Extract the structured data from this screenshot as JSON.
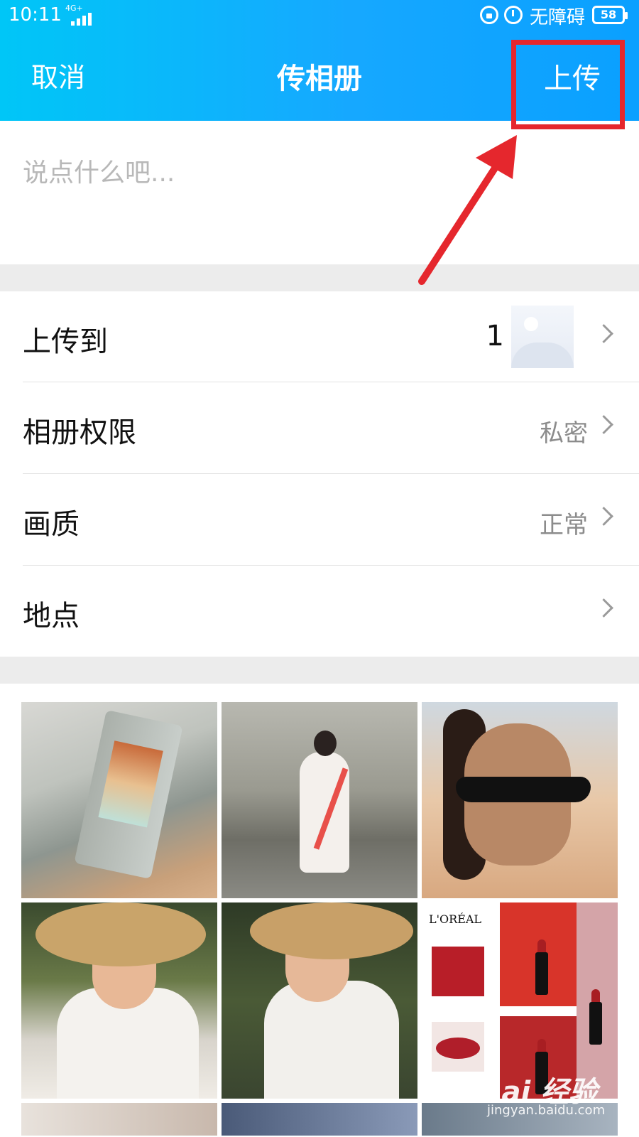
{
  "status_bar": {
    "time": "10:11",
    "network": "4G+",
    "accessibility_label": "无障碍",
    "battery": "58"
  },
  "nav": {
    "cancel_label": "取消",
    "title": "传相册",
    "upload_label": "上传"
  },
  "caption": {
    "placeholder": "说点什么吧..."
  },
  "settings": {
    "upload_to": {
      "label": "上传到",
      "count": "1"
    },
    "permission": {
      "label": "相册权限",
      "value": "私密"
    },
    "quality": {
      "label": "画质",
      "value": "正常"
    },
    "location": {
      "label": "地点",
      "value": ""
    }
  },
  "photo_grid": {
    "loreal_brand": "L'ORÉAL"
  },
  "watermark": {
    "logo": "Bai 经验",
    "url": "jingyan.baidu.com"
  },
  "colors": {
    "header_gradient_start": "#00c6f7",
    "header_gradient_end": "#0aa0ff",
    "highlight_red": "#e5272d",
    "divider_gray": "#ececec"
  },
  "icons": [
    "signal-icon",
    "lock-icon",
    "alarm-icon",
    "battery-icon",
    "chevron-right-icon",
    "album-placeholder-icon",
    "annotation-arrow-icon"
  ]
}
